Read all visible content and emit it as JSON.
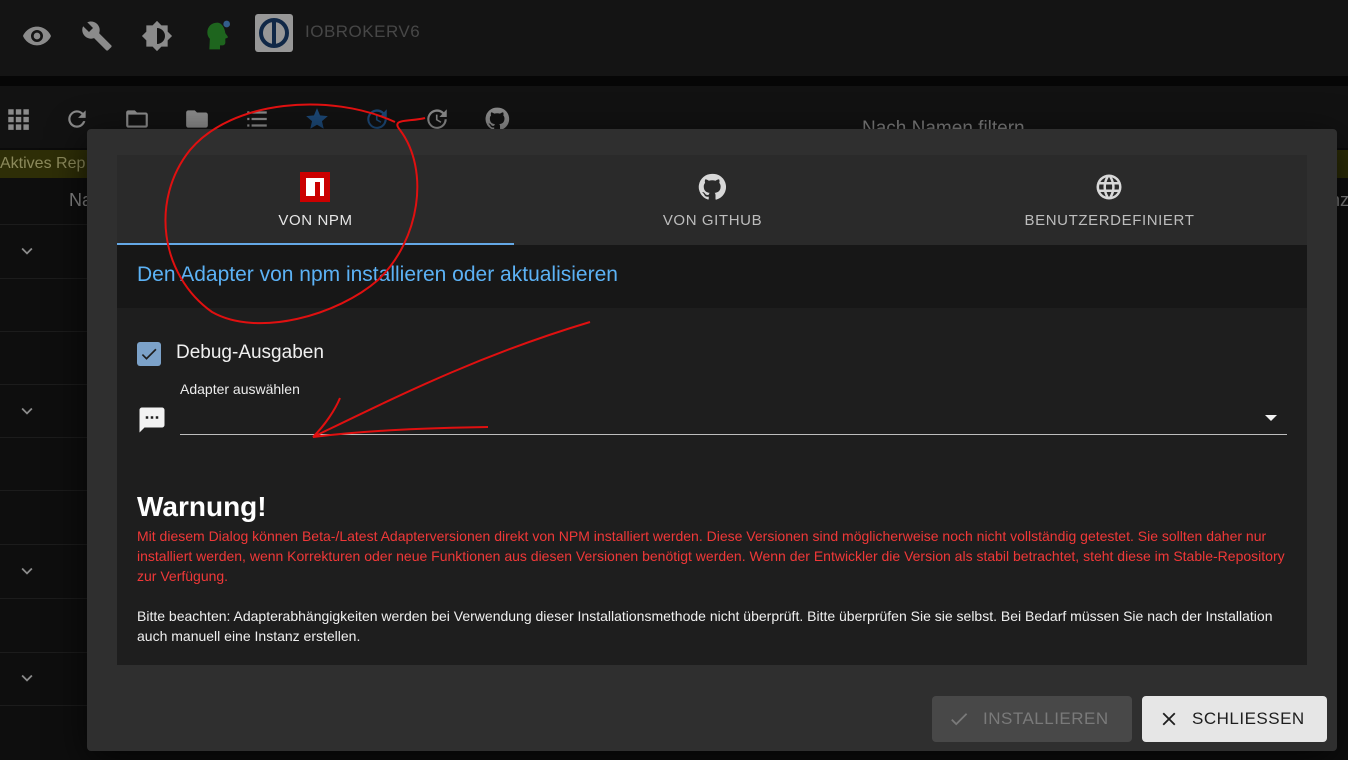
{
  "appbar": {
    "title": "IOBROKERV6",
    "icons": [
      "eye-icon",
      "wrench-icon",
      "brightness-icon",
      "user-head-icon",
      "iobroker-logo"
    ]
  },
  "toolbar": {
    "icons": [
      "grid-icon",
      "refresh-icon",
      "folder-outline-icon",
      "folder-icon",
      "list-icon",
      "star-icon",
      "update-icon",
      "update-all-icon",
      "github-icon"
    ],
    "filter_placeholder": "Nach Namen filtern"
  },
  "repo_bar": {
    "label": "Aktives Rep"
  },
  "list": {
    "header_left": "Na",
    "header_right": "nz"
  },
  "dialog": {
    "tabs": [
      {
        "label": "VON NPM",
        "icon": "npm-icon",
        "active": true
      },
      {
        "label": "VON GITHUB",
        "icon": "github-icon",
        "active": false
      },
      {
        "label": "BENUTZERDEFINIERT",
        "icon": "globe-icon",
        "active": false
      }
    ],
    "subheading": "Den Adapter von npm installieren oder aktualisieren",
    "debug_checkbox": {
      "label": "Debug-Ausgaben",
      "checked": true
    },
    "adapter_select": {
      "label": "Adapter auswählen",
      "value": ""
    },
    "warning_title": "Warnung!",
    "warning_text": "Mit diesem Dialog können Beta-/Latest Adapterversionen direkt von NPM installiert werden. Diese Versionen sind möglicherweise noch nicht vollständig getestet. Sie sollten daher nur installiert werden, wenn Korrekturen oder neue Funktionen aus diesen Versionen benötigt werden. Wenn der Entwickler die Version als stabil betrachtet, steht diese im Stable-Repository zur Verfügung.",
    "note_text": "Bitte beachten: Adapterabhängigkeiten werden bei Verwendung dieser Installationsmethode nicht überprüft. Bitte überprüfen Sie sie selbst. Bei Bedarf müssen Sie nach der Installation auch manuell eine Instanz erstellen.",
    "install_button": "INSTALLIEREN",
    "close_button": "SCHLIESSEN"
  },
  "colors": {
    "accent_blue": "#5cb2f5",
    "warning_red": "#f03838",
    "npm_red": "#cb0000",
    "annotation_red": "#e01010"
  }
}
